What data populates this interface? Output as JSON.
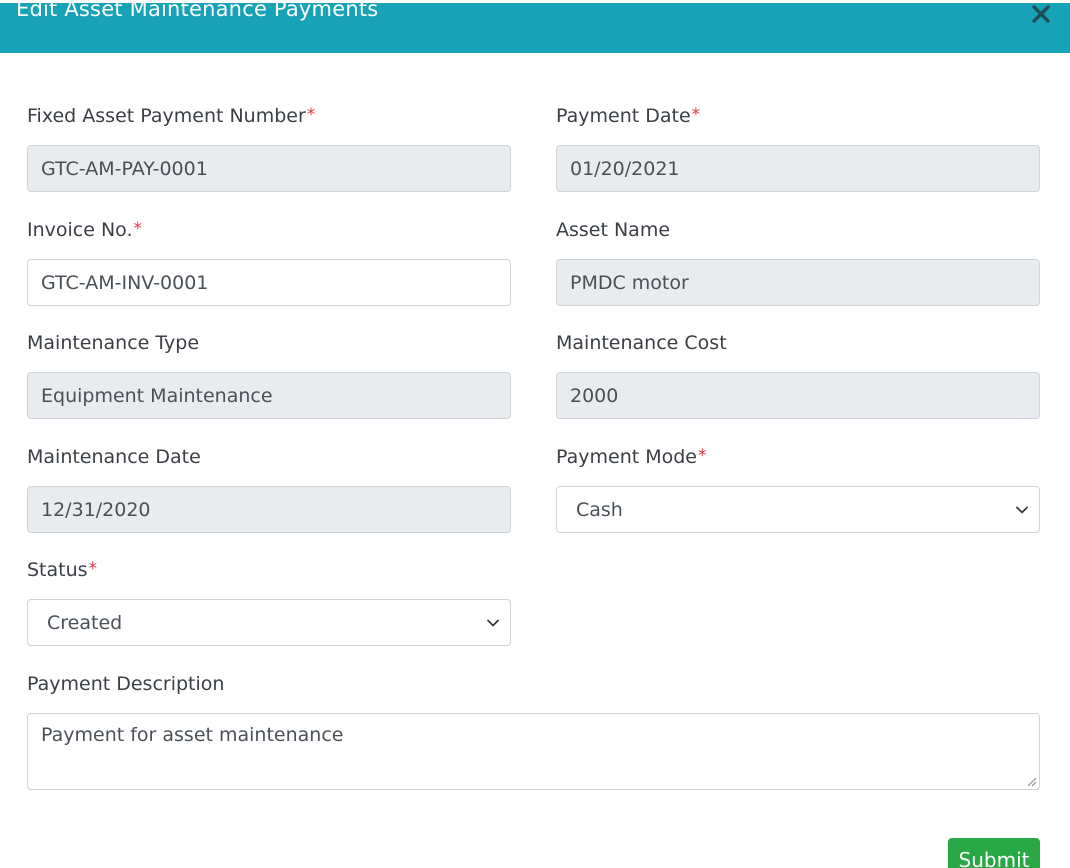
{
  "header": {
    "title": "Edit Asset Maintenance Payments",
    "close_icon": "close-icon"
  },
  "form": {
    "asset_payment_number": {
      "label": "Fixed Asset Payment Number",
      "value": "GTC-AM-PAY-0001",
      "required": true
    },
    "payment_date": {
      "label": "Payment Date",
      "value": "01/20/2021",
      "required": true
    },
    "invoice_no": {
      "label": "Invoice No.",
      "value": "GTC-AM-INV-0001",
      "required": true
    },
    "asset_name": {
      "label": "Asset Name",
      "value": "PMDC motor"
    },
    "maintenance_type": {
      "label": "Maintenance Type",
      "value": "Equipment Maintenance"
    },
    "maintenance_cost": {
      "label": "Maintenance Cost",
      "value": "2000"
    },
    "maintenance_date": {
      "label": "Maintenance Date",
      "value": "12/31/2020"
    },
    "payment_mode": {
      "label": "Payment Mode",
      "value": "Cash",
      "required": true
    },
    "status": {
      "label": "Status",
      "value": "Created",
      "required": true
    },
    "payment_description": {
      "label": "Payment Description",
      "value": "Payment for asset maintenance"
    }
  },
  "required_marker": "*",
  "submit_label": "Submit",
  "colors": {
    "header_bg": "#17a2b8",
    "required": "#dc3545",
    "readonly_bg": "#e9ecef",
    "submit_bg": "#28a745"
  }
}
